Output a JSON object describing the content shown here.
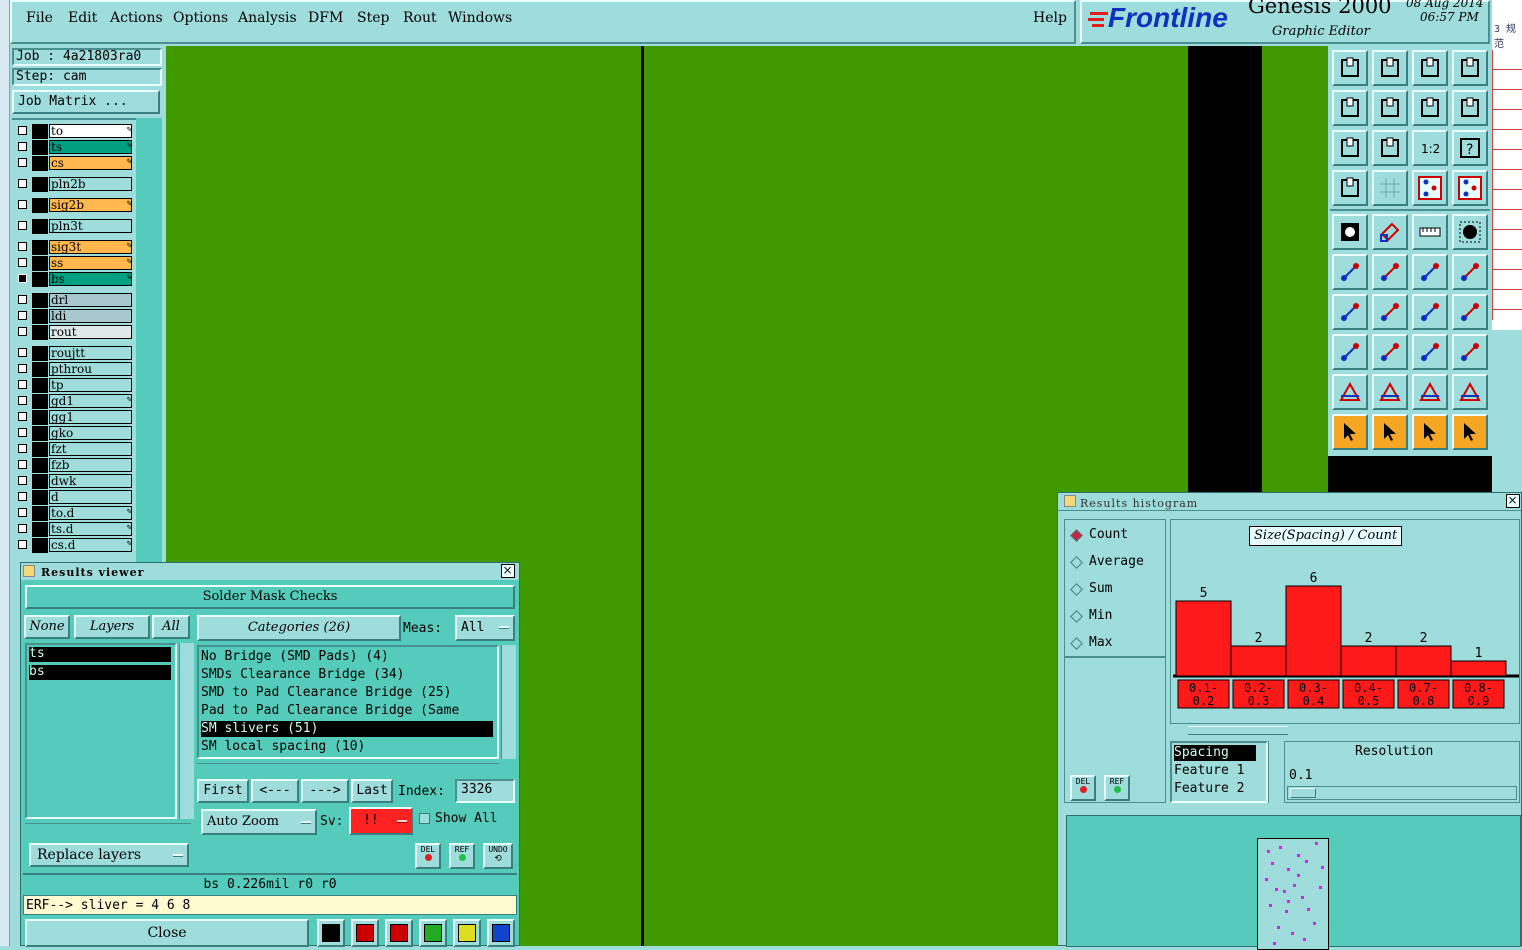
{
  "menu": {
    "items": [
      {
        "label": "File"
      },
      {
        "label": "Edit"
      },
      {
        "label": "Actions"
      },
      {
        "label": "Options"
      },
      {
        "label": "Analysis"
      },
      {
        "label": "DFM"
      },
      {
        "label": "Step"
      },
      {
        "label": "Rout"
      },
      {
        "label": "Windows"
      }
    ],
    "help": "Help"
  },
  "brand": {
    "logo": "Frontline",
    "product": "Genesis 2000",
    "subtitle": "Graphic Editor",
    "date": "08 Aug 2014",
    "time": "06:57 PM",
    "edge_text": "3 规范"
  },
  "job": {
    "job_line": "Job : 4a21803ra0",
    "step_line": "Step: cam",
    "matrix_button": "Job Matrix ..."
  },
  "layers": [
    {
      "name": "to",
      "color": "#ffffff",
      "edit": true,
      "checked": false
    },
    {
      "name": "ts",
      "color": "#00a080",
      "edit": true,
      "checked": false
    },
    {
      "name": "cs",
      "color": "#ffb84d",
      "edit": true,
      "checked": false
    },
    {
      "name": "pln2b",
      "color": "#9fdcdc",
      "edit": false,
      "checked": false
    },
    {
      "name": "sig2b",
      "color": "#ffb84d",
      "edit": true,
      "checked": false
    },
    {
      "name": "pln3t",
      "color": "#9fdcdc",
      "edit": false,
      "checked": false
    },
    {
      "name": "sig3t",
      "color": "#ffb84d",
      "edit": true,
      "checked": false
    },
    {
      "name": "ss",
      "color": "#ffb84d",
      "edit": true,
      "checked": false
    },
    {
      "name": "bs",
      "color": "#00a080",
      "edit": true,
      "checked": true
    },
    {
      "name": "drl",
      "color": "#a8c8d0",
      "edit": false,
      "checked": false
    },
    {
      "name": "ldi",
      "color": "#a8c8d0",
      "edit": false,
      "checked": false
    },
    {
      "name": "rout",
      "color": "#e0e8e8",
      "edit": false,
      "checked": false
    },
    {
      "name": "roujtt",
      "color": "#9fdcdc",
      "edit": false,
      "checked": false
    },
    {
      "name": "pthrou",
      "color": "#9fdcdc",
      "edit": false,
      "checked": false
    },
    {
      "name": "tp",
      "color": "#9fdcdc",
      "edit": false,
      "checked": false
    },
    {
      "name": "gd1",
      "color": "#9fdcdc",
      "edit": true,
      "checked": false
    },
    {
      "name": "gg1",
      "color": "#9fdcdc",
      "edit": false,
      "checked": false
    },
    {
      "name": "gko",
      "color": "#9fdcdc",
      "edit": false,
      "checked": false
    },
    {
      "name": "fzt",
      "color": "#9fdcdc",
      "edit": false,
      "checked": false
    },
    {
      "name": "fzb",
      "color": "#9fdcdc",
      "edit": false,
      "checked": false
    },
    {
      "name": "dwk",
      "color": "#9fdcdc",
      "edit": false,
      "checked": false
    },
    {
      "name": "d",
      "color": "#9fdcdc",
      "edit": false,
      "checked": false
    },
    {
      "name": "to.d",
      "color": "#9fdcdc",
      "edit": true,
      "checked": false
    },
    {
      "name": "ts.d",
      "color": "#9fdcdc",
      "edit": true,
      "checked": false
    },
    {
      "name": "cs.d",
      "color": "#9fdcdc",
      "edit": true,
      "checked": false
    }
  ],
  "results_viewer": {
    "title": "Results viewer",
    "header": "Solder Mask Checks",
    "none_btn": "None",
    "layers_btn": "Layers",
    "all_btn": "All",
    "layer_list": [
      "ts",
      "bs"
    ],
    "categories_btn": "Categories (26)",
    "meas_label": "Meas:",
    "meas_value": "All",
    "categories": [
      "No Bridge (SMD Pads) (4)",
      "SMDs Clearance Bridge (34)",
      "SMD to Pad Clearance Bridge (25)",
      "Pad to Pad Clearance Bridge (Same",
      "SM slivers (51)",
      "SM local spacing (10)"
    ],
    "selected_category": 4,
    "first_btn": "First",
    "prev_btn": "<---",
    "next_btn": "--->",
    "last_btn": "Last",
    "index_label": "Index:",
    "index_value": "3326",
    "auto_zoom": "Auto Zoom",
    "sv_label": "Sv:",
    "sv_value": "!!",
    "show_all": "Show All",
    "replace_layers": "Replace layers",
    "del": "DEL",
    "ref": "REF",
    "undo": "UNDO",
    "status": "bs 0.226mil  r0  r0",
    "erf_line": "ERF--> sliver = 4 6 8",
    "close_btn": "Close"
  },
  "histogram": {
    "title": "Results histogram",
    "modes": [
      "Count",
      "Average",
      "Sum",
      "Min",
      "Max"
    ],
    "selected_mode": 0,
    "del": "DEL",
    "ref": "REF",
    "chart_title": "Size(Spacing) / Count",
    "bin_labels": [
      "0.1-0.2",
      "0.2-0.3",
      "0.3-0.4",
      "0.4-0.5",
      "0.7-0.8",
      "0.8-0.9"
    ],
    "counts": [
      5,
      2,
      6,
      2,
      2,
      1
    ],
    "params": [
      "Spacing",
      "Feature 1",
      "Feature 2"
    ],
    "resolution_label": "Resolution",
    "resolution_value": "0.1"
  },
  "colors": {
    "panel": "#9fdcdc",
    "canvas": "#3f9a00",
    "bar": "#ff1a1a",
    "accent_orange": "#f5a623"
  },
  "icons": [
    "open-icon",
    "save-icon",
    "home-icon",
    "fit-icon",
    "snap-in-icon",
    "snap-out-icon",
    "undo-view-icon",
    "s-curve-icon",
    "zoom-fit-icon",
    "zoom-center-icon",
    "ratio-icon",
    "help-icon",
    "measure-icon",
    "grid-icon",
    "layer-compare-icon",
    "layer-stack-icon",
    "pad-icon",
    "polygon-icon",
    "ruler-icon",
    "circle-icon",
    "connect-icon",
    "cross-icon",
    "snap-point-icon",
    "arrow-point-icon",
    "angle-icon",
    "line-icon",
    "arc-icon",
    "mirror-icon",
    "select-box-icon",
    "segment-icon",
    "dimension-icon",
    "shapes-icon",
    "triangle-icon",
    "triangle-a-icon",
    "triangle-b-icon",
    "triangle-c-icon",
    "pointer-icon",
    "pointer-box-icon",
    "pointer-circle-icon",
    "pointer-net-icon"
  ]
}
